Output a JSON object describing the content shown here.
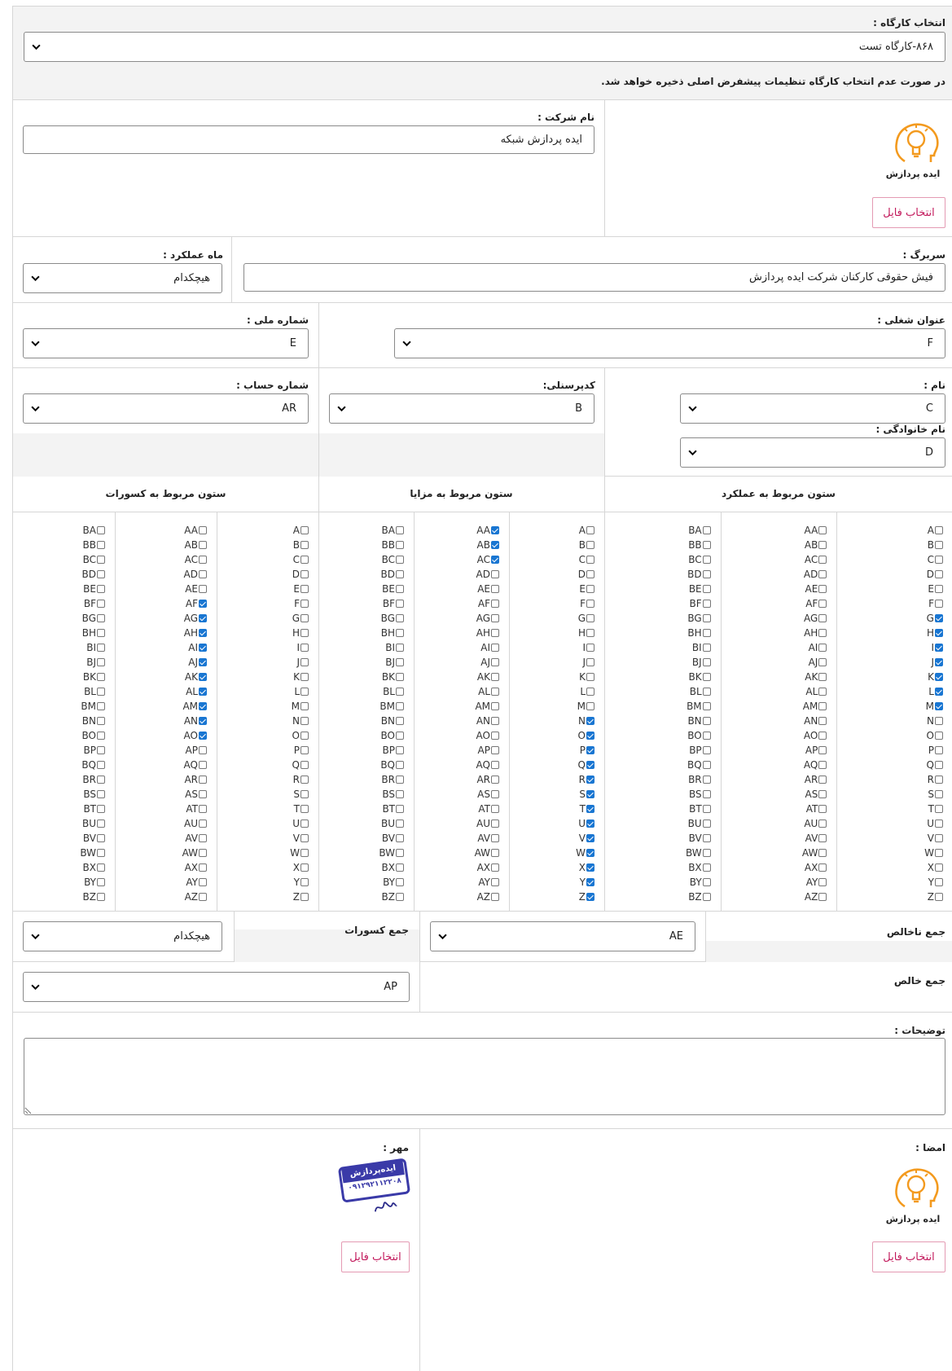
{
  "workshop": {
    "label": "انتخاب کارگاه :",
    "value": "۸۶۸-کارگاه تست",
    "note": "در صورت عدم انتخاب کارگاه تنظیمات پیشفرض اصلی ذخیره خواهد شد."
  },
  "company": {
    "label": "نام شرکت :",
    "value": "ایده پردازش شبکه",
    "logo_text": "ایده پردازش",
    "file_button": "انتخاب فایل"
  },
  "header_row": {
    "title_label": "سربرگ :",
    "title_value": "فیش حقوقی کارکنان شرکت ایده پردازش",
    "month_label": "ماه عملکرد :",
    "month_value": "هیچکدام"
  },
  "job_row": {
    "job_label": "عنوان شغلی :",
    "job_value": "F",
    "national_label": "شماره ملی :",
    "national_value": "E"
  },
  "person_row": {
    "name_label": "نام :",
    "name_value": "C",
    "family_label": "نام خانوادگی :",
    "family_value": "D",
    "code_label": "کدپرسنلی:",
    "code_value": "B",
    "account_label": "شماره حساب :",
    "account_value": "AR"
  },
  "columns": {
    "performance_header": "ستون مربوط به عملکرد",
    "benefits_header": "ستون مربوط به مزایا",
    "deductions_header": "ستون مربوط به کسورات",
    "groups": [
      [
        "A",
        "B",
        "C",
        "D",
        "E",
        "F",
        "G",
        "H",
        "I",
        "J",
        "K",
        "L",
        "M",
        "N",
        "O",
        "P",
        "Q",
        "R",
        "S",
        "T",
        "U",
        "V",
        "W",
        "X",
        "Y",
        "Z"
      ],
      [
        "AA",
        "AB",
        "AC",
        "AD",
        "AE",
        "AF",
        "AG",
        "AH",
        "AI",
        "AJ",
        "AK",
        "AL",
        "AM",
        "AN",
        "AO",
        "AP",
        "AQ",
        "AR",
        "AS",
        "AT",
        "AU",
        "AV",
        "AW",
        "AX",
        "AY",
        "AZ"
      ],
      [
        "BA",
        "BB",
        "BC",
        "BD",
        "BE",
        "BF",
        "BG",
        "BH",
        "BI",
        "BJ",
        "BK",
        "BL",
        "BM",
        "BN",
        "BO",
        "BP",
        "BQ",
        "BR",
        "BS",
        "BT",
        "BU",
        "BV",
        "BW",
        "BX",
        "BY",
        "BZ"
      ]
    ],
    "performance_checked": [
      "G",
      "H",
      "I",
      "J",
      "K",
      "L",
      "M"
    ],
    "benefits_checked": [
      "N",
      "O",
      "P",
      "Q",
      "R",
      "S",
      "T",
      "U",
      "V",
      "W",
      "X",
      "Y",
      "Z",
      "AA",
      "AB",
      "AC"
    ],
    "deductions_checked": [
      "AF",
      "AG",
      "AH",
      "AI",
      "AJ",
      "AK",
      "AL",
      "AM",
      "AN",
      "AO"
    ]
  },
  "totals": {
    "gross_label": "جمع ناخالص",
    "gross_value": "AE",
    "deductions_label": "جمع کسورات",
    "deductions_value": "هیچکدام",
    "net_label": "جمع خالص",
    "net_value": "AP"
  },
  "notes": {
    "label": "توضیحات :",
    "value": ""
  },
  "signature": {
    "label": "امضا :",
    "logo_text": "ایده پردازش",
    "file_button": "انتخاب فایل"
  },
  "stamp": {
    "label": "مهر :",
    "stamp_title": "ایده‌پردازش",
    "stamp_phone": "۰۹۱۲۹۲۱۱۲۲۰۸",
    "file_button": "انتخاب فایل"
  }
}
